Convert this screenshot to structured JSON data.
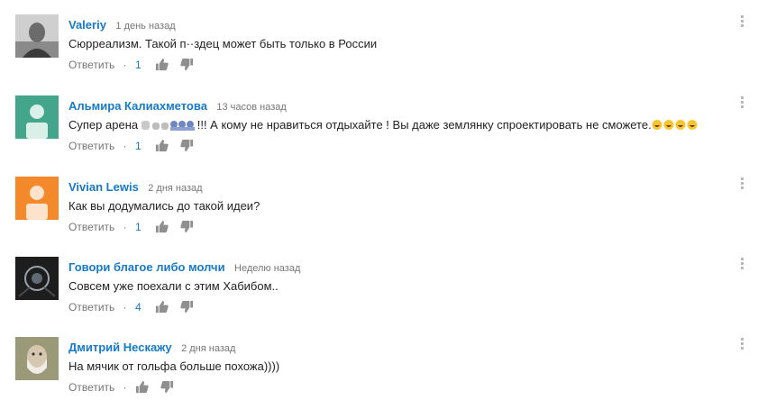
{
  "comments": [
    {
      "author": "Valeriy",
      "time": "1 день назад",
      "text": "Сюрреализм. Такой п··здец может быть только в России",
      "reply": "Ответить",
      "likes": "1",
      "avatar_color": "#d0d0d0"
    },
    {
      "author": "Альмира Калиахметова",
      "time": "13 часов назад",
      "text_before": "Супер арена ",
      "text_after": "!!! А кому не нравиться отдыхайте ! Вы даже землянку спроектировать не сможете.",
      "reply": "Ответить",
      "likes": "1",
      "avatar_color": "#43a58b"
    },
    {
      "author": "Vivian Lewis",
      "time": "2 дня назад",
      "text": "Как вы додумались до такой идеи?",
      "reply": "Ответить",
      "likes": "1",
      "avatar_color": "#f3892a"
    },
    {
      "author": "Говори благое либо молчи",
      "time": "Неделю назад",
      "text": "Совсем уже поехали с этим Хабибом..",
      "reply": "Ответить",
      "likes": "4",
      "avatar_color": "#1d1d1d"
    },
    {
      "author": "Дмитрий Нескажу",
      "time": "2 дня назад",
      "text": "На мячик от гольфа больше похожа))))",
      "reply": "Ответить",
      "likes": "",
      "avatar_color": "#9a9a78"
    }
  ],
  "icons": {
    "like": "thumb-up-icon",
    "dislike": "thumb-down-icon",
    "menu": "more-vertical-icon"
  },
  "colors": {
    "author": "#167ac6",
    "meta": "#767676",
    "text": "#222222"
  }
}
